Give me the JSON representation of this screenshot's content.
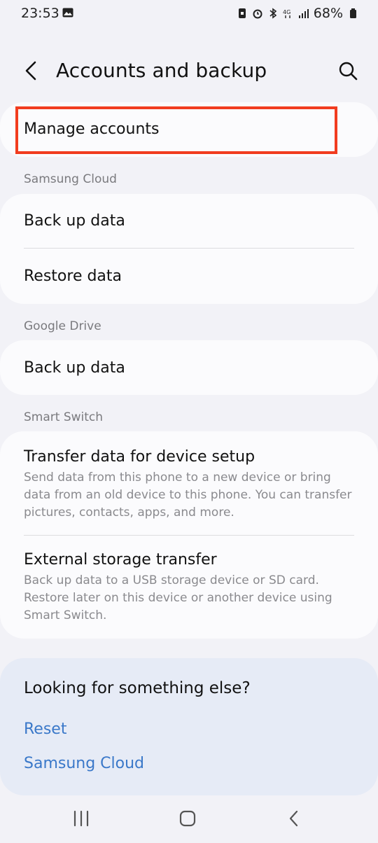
{
  "status": {
    "time": "23:53",
    "battery": "68%"
  },
  "header": {
    "title": "Accounts and backup"
  },
  "items": {
    "manage_accounts": "Manage accounts",
    "samsung_cloud_section": "Samsung Cloud",
    "sc_backup": "Back up data",
    "sc_restore": "Restore data",
    "google_drive_section": "Google Drive",
    "gd_backup": "Back up data",
    "smart_switch_section": "Smart Switch",
    "transfer_title": "Transfer data for device setup",
    "transfer_sub": "Send data from this phone to a new device or bring data from an old device to this phone. You can transfer pictures, contacts, apps, and more.",
    "external_title": "External storage transfer",
    "external_sub": "Back up data to a USB storage device or SD card. Restore later on this device or another device using Smart Switch."
  },
  "suggestions": {
    "question": "Looking for something else?",
    "links": [
      "Reset",
      "Samsung Cloud"
    ]
  },
  "colors": {
    "accent_link": "#3a78c9",
    "highlight": "#f13c1f"
  }
}
